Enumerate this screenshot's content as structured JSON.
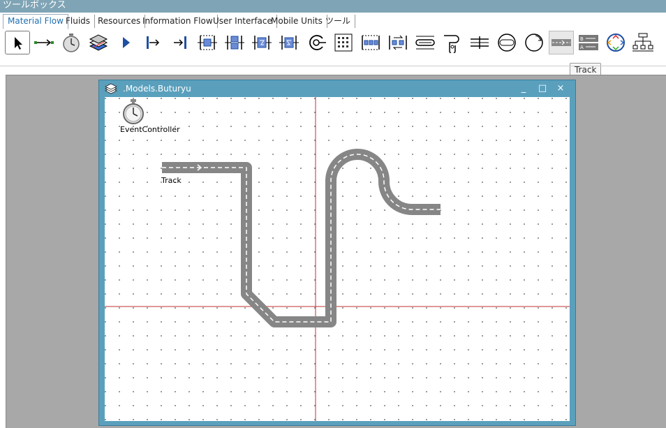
{
  "window": {
    "title": "ツールボックス"
  },
  "tabs": [
    {
      "label": "Material Flow",
      "active": true
    },
    {
      "label": "Fluids"
    },
    {
      "label": "Resources"
    },
    {
      "label": "Information Flow"
    },
    {
      "label": "User Interface"
    },
    {
      "label": "Mobile Units"
    },
    {
      "label": "ツール"
    }
  ],
  "toolbar": {
    "items": [
      "pointer-icon",
      "connector-icon",
      "event-controller-icon",
      "frame-icon",
      "interface-icon",
      "source-icon",
      "drain-icon",
      "single-proc-icon",
      "parallel-proc-icon",
      "assembly-icon",
      "dismantle-icon",
      "cycle-icon",
      "store-icon",
      "buffer-icon",
      "placebuffer-icon",
      "sorter-icon",
      "line-icon",
      "angular-converter-icon",
      "turntable-icon",
      "turnplate-icon",
      "track-icon",
      "twolane-track-icon",
      "turntable2-icon",
      "distributor-icon"
    ],
    "tooltip": "Track"
  },
  "model": {
    "title": ".Models.Buturyu",
    "controls": {
      "minimize": "_",
      "maximize": "□",
      "close": "×"
    },
    "event_controller_label": "EventController",
    "track_label": "Track"
  }
}
